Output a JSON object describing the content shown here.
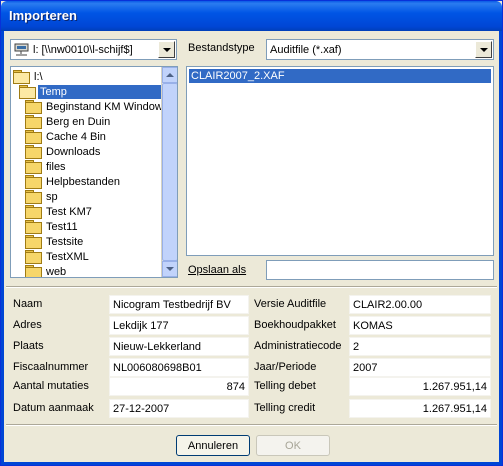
{
  "window": {
    "title": "Importeren"
  },
  "drive": {
    "value": "l: [\\\\nw0010\\l-schijf$]"
  },
  "filetype": {
    "label": "Bestandstype",
    "value": "Auditfile (*.xaf)"
  },
  "tree": {
    "root": "l:\\",
    "selected": "Temp",
    "items": [
      "Beginstand KM Windows",
      "Berg en Duin",
      "Cache 4 Bin",
      "Downloads",
      "files",
      "Helpbestanden",
      "sp",
      "Test KM7",
      "Test11",
      "Testsite",
      "TestXML",
      "web"
    ]
  },
  "files": {
    "items": [
      "CLAIR2007_2.XAF"
    ]
  },
  "saveas": {
    "label": "Opslaan als",
    "value": ""
  },
  "info": {
    "left": [
      {
        "label": "Naam",
        "value": "Nicogram Testbedrijf BV"
      },
      {
        "label": "Adres",
        "value": "Lekdijk 177"
      },
      {
        "label": "Plaats",
        "value": "Nieuw-Lekkerland"
      },
      {
        "label": "Fiscaalnummer",
        "value": "NL006080698B01"
      },
      {
        "label": "Aantal mutaties",
        "value": "874"
      },
      {
        "label": "Datum aanmaak",
        "value": "27-12-2007"
      }
    ],
    "right": [
      {
        "label": "Versie Auditfile",
        "value": "CLAIR2.00.00"
      },
      {
        "label": "Boekhoudpakket",
        "value": "KOMAS"
      },
      {
        "label": "Administratiecode",
        "value": "2"
      },
      {
        "label": "Jaar/Periode",
        "value": "2007"
      },
      {
        "label": "Telling debet",
        "value": "1.267.951,14"
      },
      {
        "label": "Telling credit",
        "value": "1.267.951,14"
      }
    ]
  },
  "buttons": {
    "cancel": "Annuleren",
    "ok": "OK"
  }
}
